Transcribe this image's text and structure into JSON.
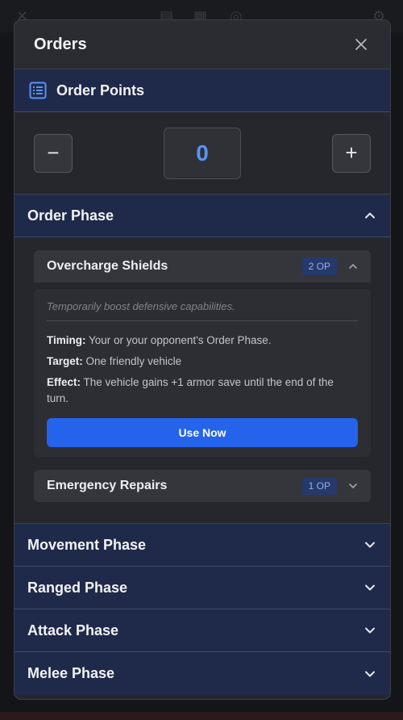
{
  "modal": {
    "title": "Orders",
    "close_icon": "close-icon"
  },
  "order_points": {
    "title": "Order Points",
    "icon": "list-icon",
    "value": "0",
    "minus": "−",
    "plus": "+"
  },
  "order_phase": {
    "title": "Order Phase",
    "expanded": true,
    "orders": [
      {
        "name": "Overcharge Shields",
        "cost": "2 OP",
        "description": "Temporarily boost defensive capabilities.",
        "timing_label": "Timing:",
        "timing": "Your or your opponent's Order Phase.",
        "target_label": "Target:",
        "target": "One friendly vehicle",
        "effect_label": "Effect:",
        "effect": "The vehicle gains +1 armor save until the end of the turn.",
        "button": "Use Now"
      },
      {
        "name": "Emergency Repairs",
        "cost": "1 OP"
      }
    ]
  },
  "phases": [
    {
      "title": "Movement Phase"
    },
    {
      "title": "Ranged Phase"
    },
    {
      "title": "Attack Phase"
    },
    {
      "title": "Melee Phase"
    }
  ],
  "colors": {
    "accent": "#2563eb",
    "header_bg": "#1f2a4a",
    "value": "#5b93f5"
  }
}
